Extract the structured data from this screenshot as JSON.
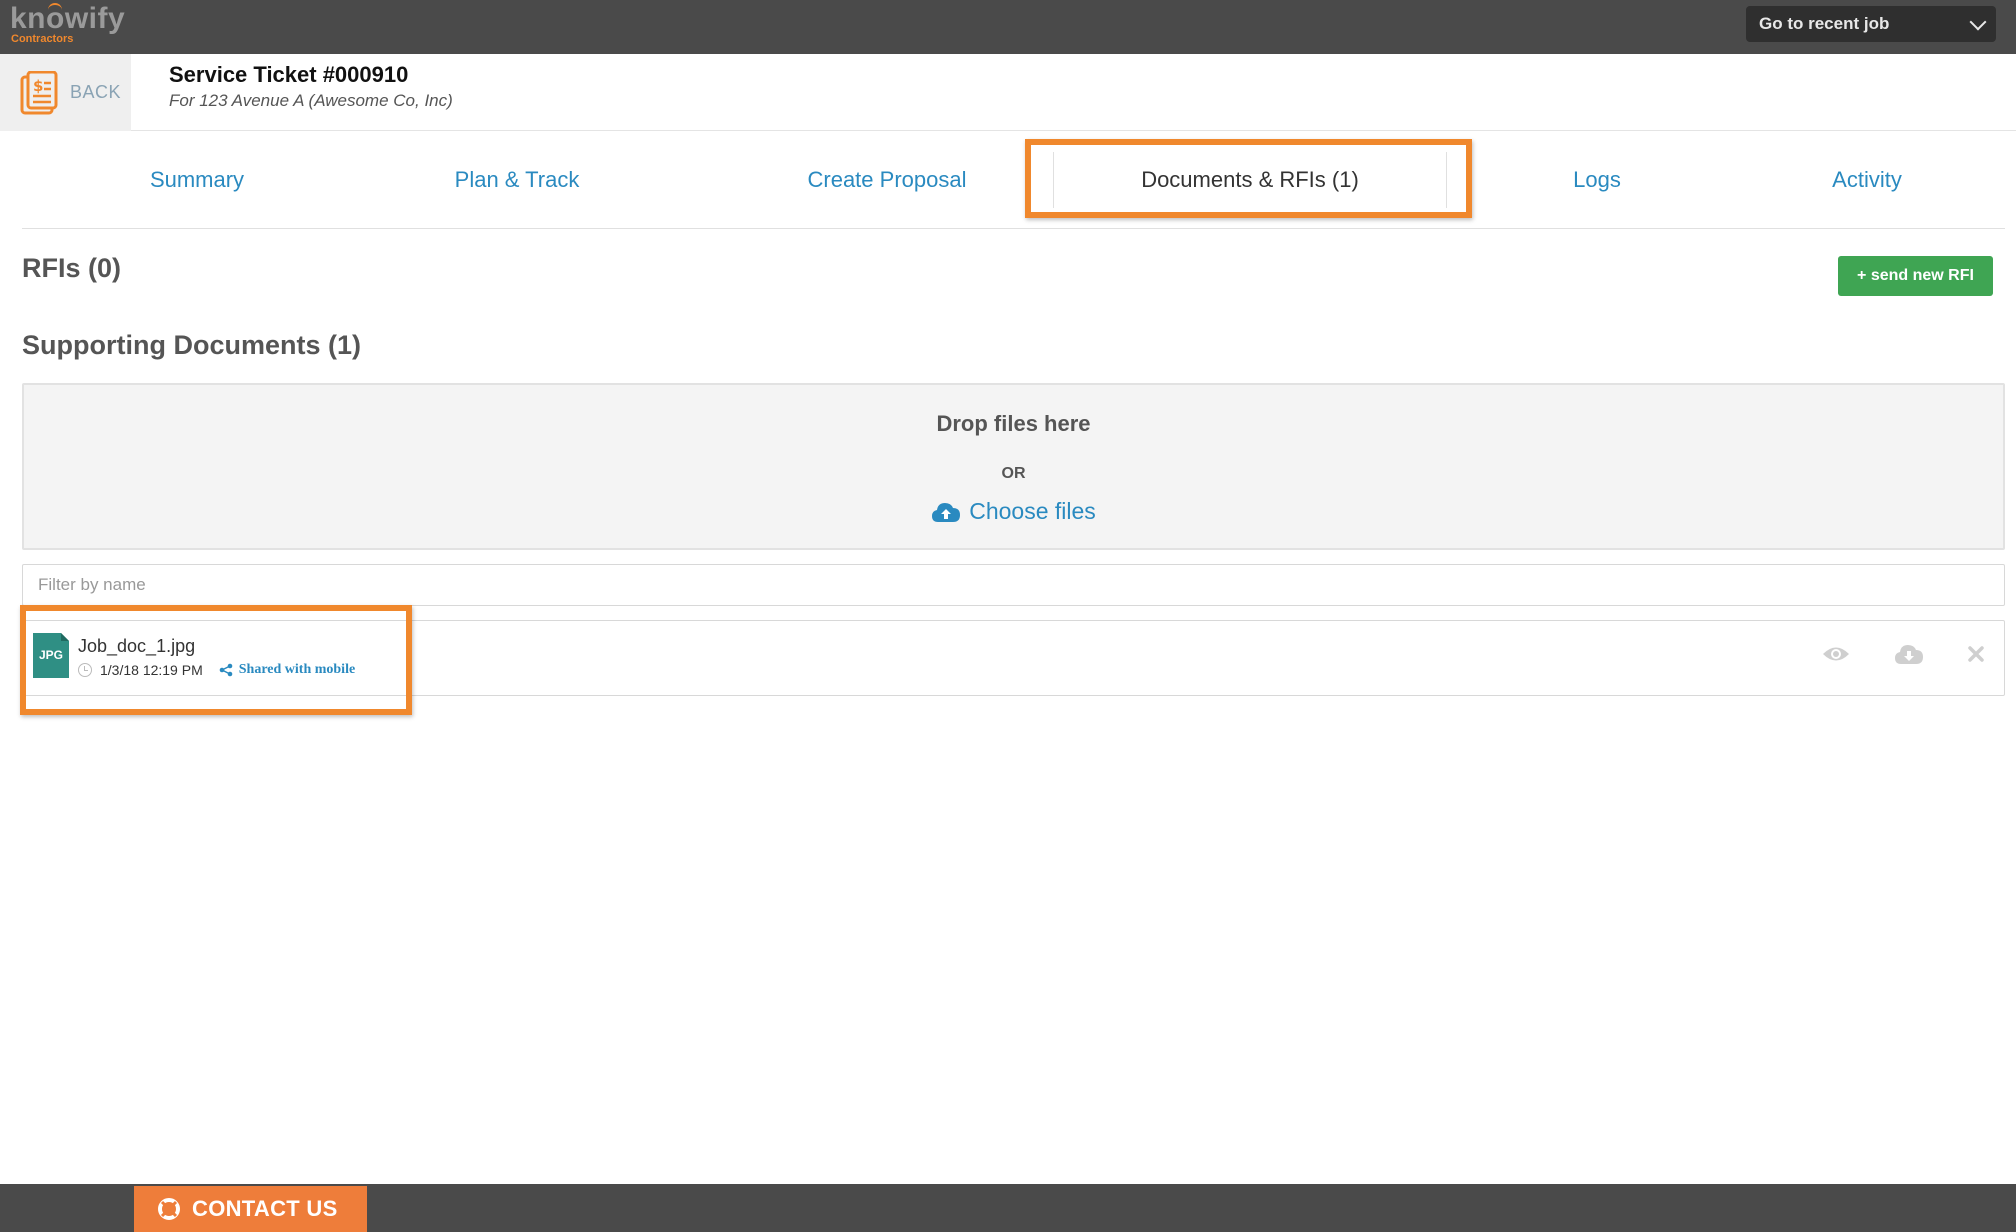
{
  "brand": {
    "name": "knowify",
    "subtitle": "Contractors",
    "accent_color": "#f0882d"
  },
  "topbar": {
    "recent_job_label": "Go to recent job"
  },
  "header": {
    "back_label": "BACK",
    "title": "Service Ticket #000910",
    "subtitle": "For 123 Avenue A (Awesome Co, Inc)"
  },
  "tabs": [
    {
      "label": "Summary"
    },
    {
      "label": "Plan & Track"
    },
    {
      "label": "Create Proposal"
    },
    {
      "label": "Documents & RFIs (1)",
      "active": true
    },
    {
      "label": "Logs"
    },
    {
      "label": "Activity"
    }
  ],
  "rfis": {
    "title": "RFIs (0)",
    "send_button": "+ send new RFI",
    "button_color": "#3fa553"
  },
  "documents": {
    "title": "Supporting Documents (1)",
    "dropzone": {
      "title": "Drop files here",
      "or_label": "OR",
      "choose_label": "Choose files"
    },
    "filter_placeholder": "Filter by name",
    "files": [
      {
        "type_badge": "JPG",
        "name": "Job_doc_1.jpg",
        "timestamp": "1/3/18 12:19 PM",
        "share_label": "Shared with mobile"
      }
    ]
  },
  "footer": {
    "contact_label": "CONTACT US"
  },
  "icons": {
    "back": "document-dollar-icon",
    "dropdown": "chevron-down-icon",
    "upload": "cloud-upload-icon",
    "clock": "clock-icon",
    "share": "share-icon",
    "view": "eye-icon",
    "download": "cloud-download-icon",
    "delete": "close-icon",
    "contact": "lifebuoy-icon"
  }
}
